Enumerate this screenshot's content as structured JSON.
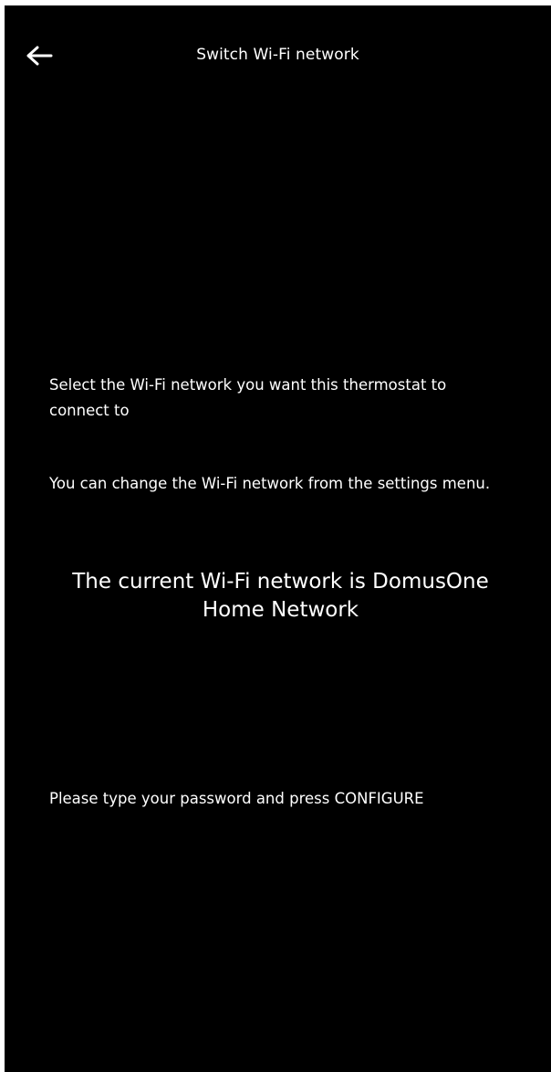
{
  "header": {
    "title": "Switch Wi-Fi network",
    "back_icon": "arrow-left-icon"
  },
  "content": {
    "select_instruction": "Select the Wi-Fi network you want this thermostat to connect to",
    "settings_note": "You can change the Wi-Fi network from the settings menu.",
    "current_network_message": "The current Wi-Fi network is DomusOne Home Network",
    "password_instruction": "Please type your password and press CONFIGURE"
  },
  "colors": {
    "background": "#000000",
    "text": "#ffffff"
  }
}
